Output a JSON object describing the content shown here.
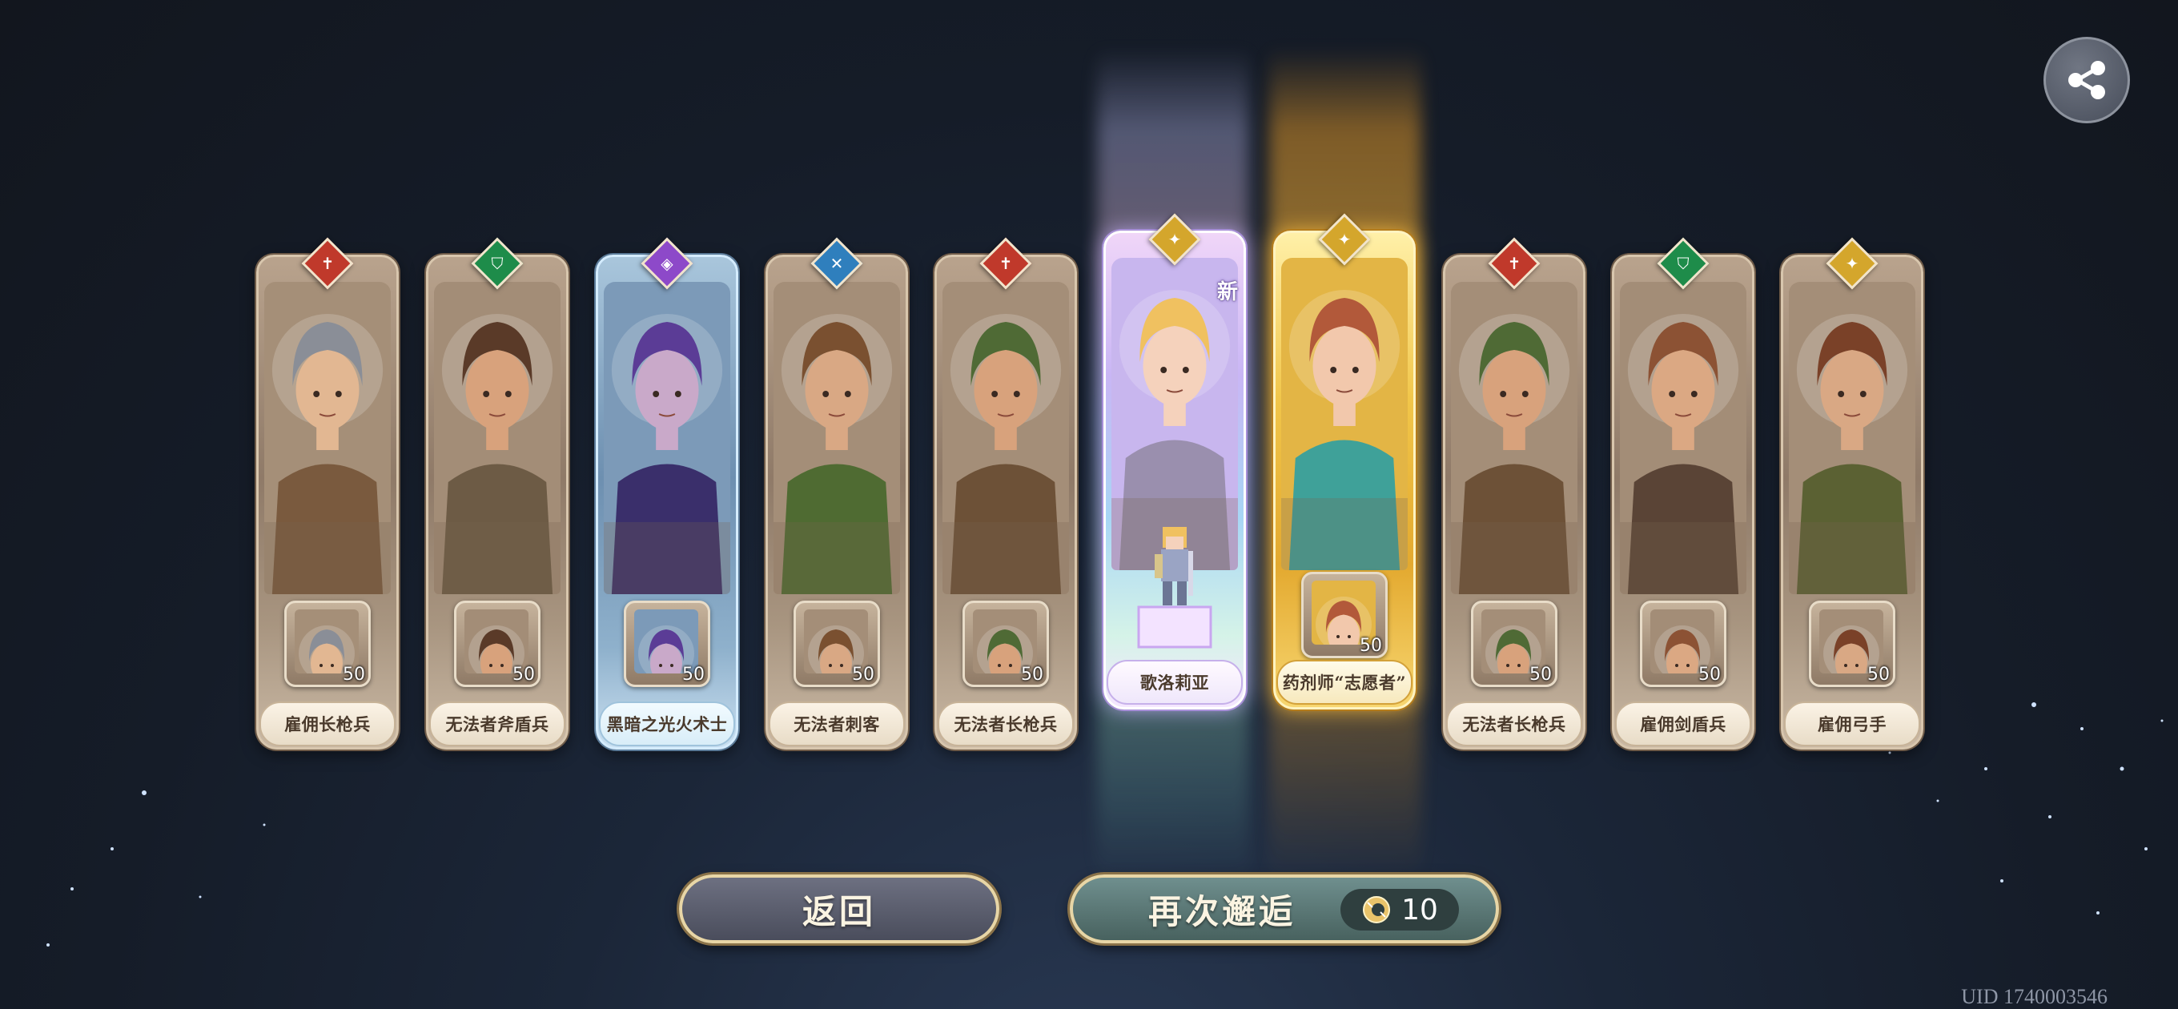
{
  "cards": [
    {
      "name": "雇佣长枪兵",
      "count": "50",
      "rarity": "normal",
      "class_icon": "spear-class-icon",
      "emblem_color": "#c0392b",
      "hair": "#8a8e97",
      "skin": "#e2b792",
      "cloth": "#7a5a3e",
      "bg": "#a58f78"
    },
    {
      "name": "无法者斧盾兵",
      "count": "50",
      "rarity": "normal",
      "class_icon": "shield-class-icon",
      "emblem_color": "#1e8c4a",
      "hair": "#5a3a28",
      "skin": "#d8a27c",
      "cloth": "#6d5b45",
      "bg": "#a38d77"
    },
    {
      "name": "黑暗之光火术士",
      "count": "50",
      "rarity": "blue",
      "class_icon": "magic-class-icon",
      "emblem_color": "#8d49c9",
      "hair": "#5b3c96",
      "skin": "#c9a9c9",
      "cloth": "#3a2f6b",
      "bg": "#7c9ab8"
    },
    {
      "name": "无法者刺客",
      "count": "50",
      "rarity": "normal",
      "class_icon": "dagger-class-icon",
      "emblem_color": "#2f7fbd",
      "hair": "#7a5030",
      "skin": "#d9a884",
      "cloth": "#4f6b32",
      "bg": "#a48e78"
    },
    {
      "name": "无法者长枪兵",
      "count": "50",
      "rarity": "normal",
      "class_icon": "spear-class-icon",
      "emblem_color": "#c0392b",
      "hair": "#4f6a35",
      "skin": "#d8a27c",
      "cloth": "#6d5137",
      "bg": "#a48e78"
    },
    {
      "name": "歌洛莉亚",
      "count": "",
      "rarity": "rainbow",
      "class_icon": "star-class-icon",
      "emblem_color": "#d4a62c",
      "hair": "#f0c160",
      "skin": "#f5d2bc",
      "cloth": "#9a8fae",
      "bg": "#c8b6ee",
      "badge": "新"
    },
    {
      "name": "药剂师“志愿者”",
      "count": "50",
      "rarity": "gold",
      "class_icon": "star-class-icon",
      "emblem_color": "#d4a62c",
      "hair": "#b2593a",
      "skin": "#f2c8ac",
      "cloth": "#3fa199",
      "bg": "#e3b545"
    },
    {
      "name": "无法者长枪兵",
      "count": "50",
      "rarity": "normal",
      "class_icon": "spear-class-icon",
      "emblem_color": "#c0392b",
      "hair": "#4f6a35",
      "skin": "#d8a27c",
      "cloth": "#6d5137",
      "bg": "#a48e78"
    },
    {
      "name": "雇佣剑盾兵",
      "count": "50",
      "rarity": "normal",
      "class_icon": "shield-class-icon",
      "emblem_color": "#1e8c4a",
      "hair": "#8c5234",
      "skin": "#dba883",
      "cloth": "#5a4436",
      "bg": "#a38d77"
    },
    {
      "name": "雇佣弓手",
      "count": "50",
      "rarity": "normal",
      "class_icon": "star-class-icon",
      "emblem_color": "#d4a62c",
      "hair": "#7a4128",
      "skin": "#d9a884",
      "cloth": "#5b6133",
      "bg": "#a48e78"
    }
  ],
  "buttons": {
    "back": "返回",
    "again": "再次邂逅",
    "cost": "10"
  },
  "uid": "UID 1740003546"
}
